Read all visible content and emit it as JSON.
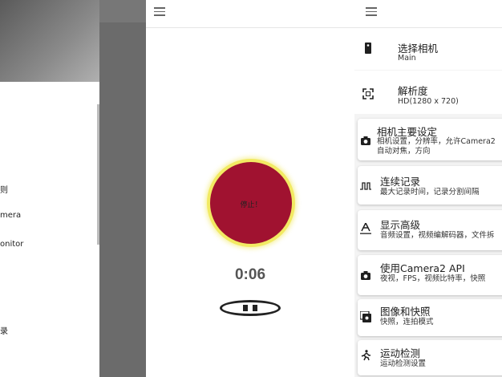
{
  "left_drawer": {
    "items": [
      "则",
      "mera",
      "onitor",
      "录"
    ]
  },
  "camera_screen": {
    "record_button_label": "停止！",
    "timer": "0:06"
  },
  "settings": {
    "select_camera": {
      "title": "选择相机",
      "value": "Main"
    },
    "resolution": {
      "title": "解析度",
      "value": "HD(1280 x 720)"
    },
    "cards": [
      {
        "title": "相机主要设定",
        "sub1": "相机设置，分辨率，允许Camera2",
        "sub2": "自动对焦，方向",
        "icon": "camera-icon"
      },
      {
        "title": "连续记录",
        "sub1": "最大记录时间，记录分割间隔",
        "sub2": "",
        "icon": "pulse-wave-icon"
      },
      {
        "title": "显示高级",
        "sub1": "音频设置，视频编解码器，文件拆",
        "sub2": "",
        "icon": "font-a-icon"
      },
      {
        "title": "使用Camera2 API",
        "sub1": "夜视，FPS，视频比特率，快照",
        "sub2": "",
        "icon": "camera-icon"
      },
      {
        "title": "图像和快照",
        "sub1": "快照，连拍模式",
        "sub2": "",
        "icon": "burst-photo-icon"
      },
      {
        "title": "运动检测",
        "sub1": "运动检测设置",
        "sub2": "",
        "icon": "running-person-icon"
      }
    ]
  },
  "colors": {
    "record_button": "#a01230",
    "record_ring": "#f2ea63"
  }
}
